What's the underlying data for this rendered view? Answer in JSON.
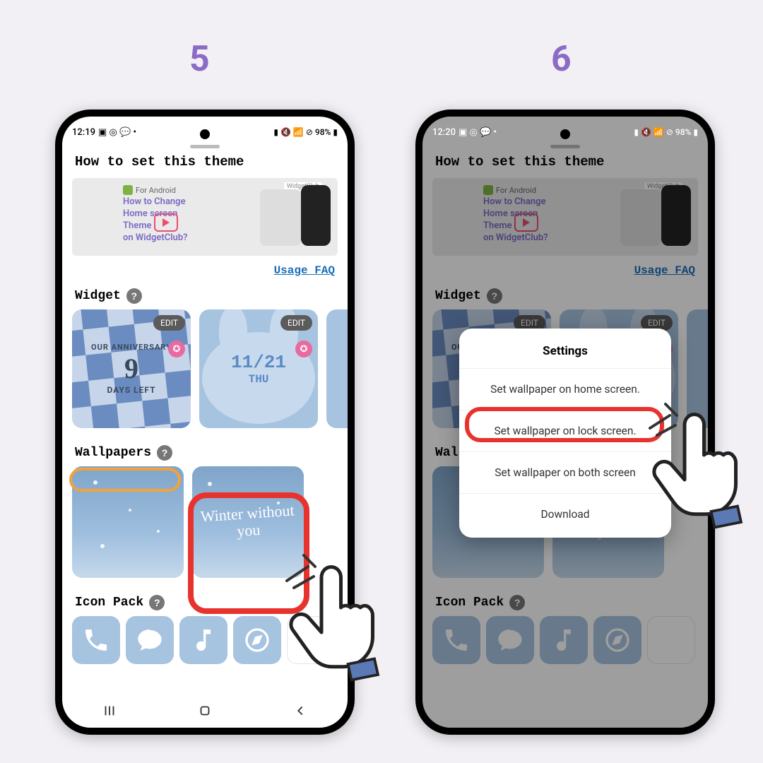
{
  "step_labels": {
    "five": "5",
    "six": "6"
  },
  "status": {
    "time_left": "12:19",
    "time_right": "12:20",
    "battery": "98%"
  },
  "sheet": {
    "title": "How to set this theme",
    "banner": {
      "platform": "For Android",
      "title_line1": "How to Change",
      "title_line2": "Home screen",
      "title_line3": "Theme",
      "title_line4": "on WidgetClub?",
      "chip": "WidgetClub"
    },
    "faq_link": "Usage FAQ",
    "sections": {
      "widget": "Widget",
      "wallpapers": "Wallpapers",
      "icon_pack": "Icon Pack"
    },
    "widgets": [
      {
        "line1": "OUR ANNIVERSARY",
        "line2": "9",
        "line3": "DAYS LEFT",
        "edit": "EDIT"
      },
      {
        "line1": "11/21",
        "line2": "THU",
        "edit": "EDIT"
      }
    ],
    "wallpaper_cursive": "Winter without you",
    "icons": [
      "phone-icon",
      "chat-icon",
      "music-icon",
      "compass-icon"
    ]
  },
  "dialog": {
    "title": "Settings",
    "opt_home": "Set wallpaper on home screen.",
    "opt_lock": "Set wallpaper on lock screen.",
    "opt_both": "Set wallpaper on both screen",
    "opt_download": "Download"
  },
  "colors": {
    "accent_purple": "#8b6bc4",
    "annotation_red": "#e8322d",
    "annotation_orange": "#f2a23c",
    "link_blue": "#1a6fb8",
    "theme_blue": "#a6c3e0"
  }
}
